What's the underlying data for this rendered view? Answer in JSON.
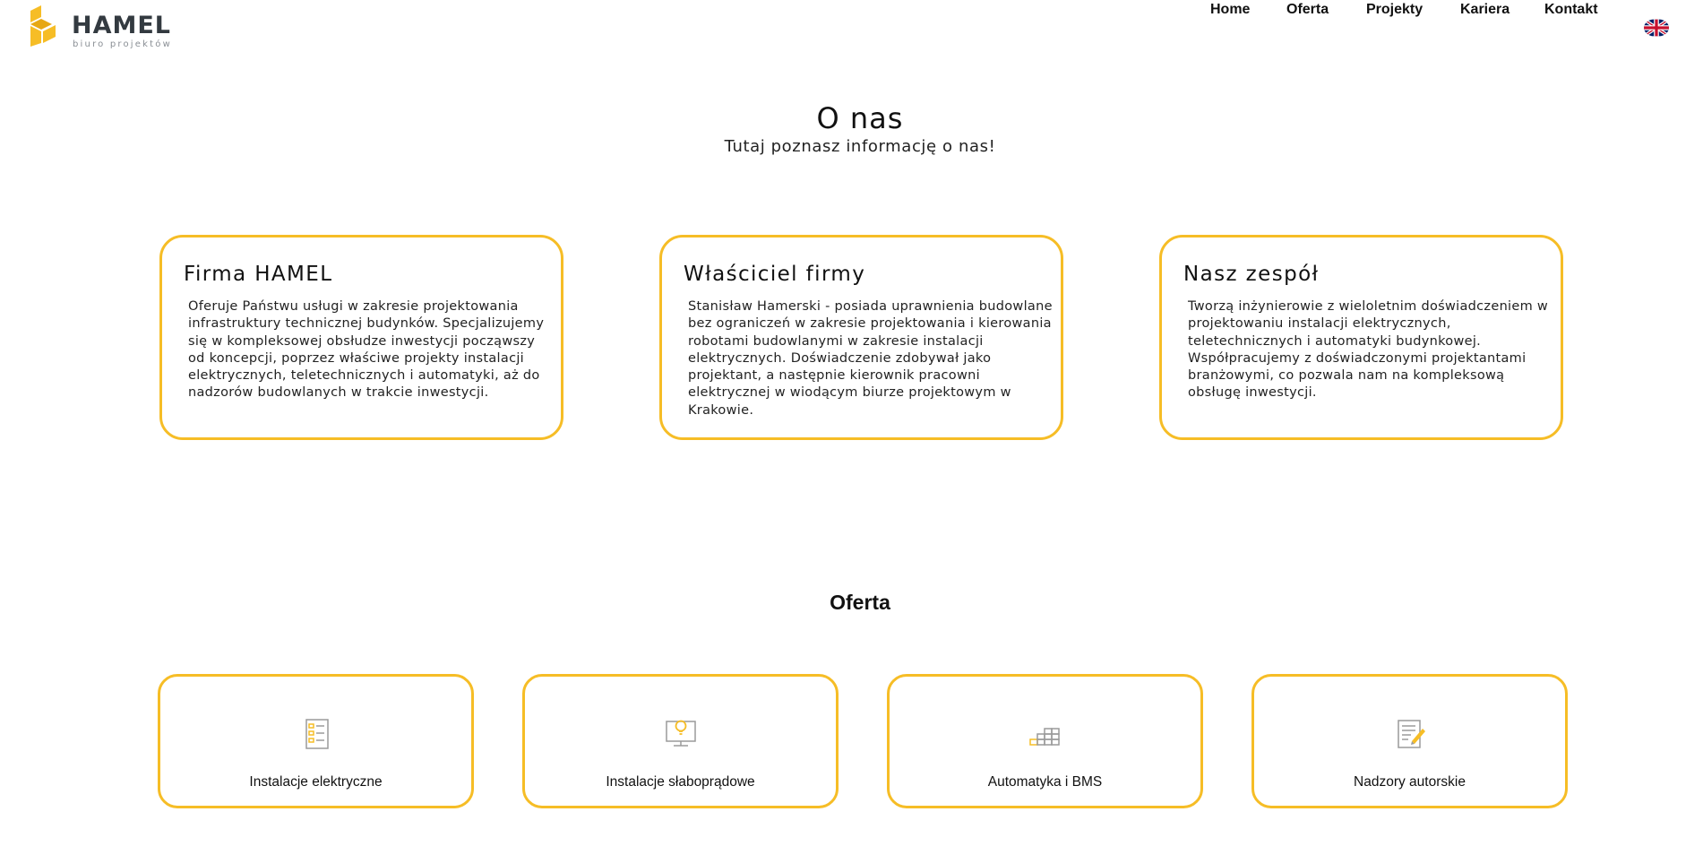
{
  "brand": {
    "name": "HAMEL",
    "tagline": "biuro projektów",
    "accent_color": "#f6bd26"
  },
  "nav": {
    "items": [
      {
        "label": "Home"
      },
      {
        "label": "Oferta"
      },
      {
        "label": "Projekty"
      },
      {
        "label": "Kariera"
      },
      {
        "label": "Kontakt"
      }
    ],
    "language_icon": "uk-flag-icon"
  },
  "about": {
    "title": "O nas",
    "subtitle": "Tutaj poznasz informację o nas!",
    "cards": [
      {
        "title": "Firma HAMEL",
        "text": "Oferuje Państwu usługi w zakresie projektowania infrastruktury technicznej budynków. Specjalizujemy się w kompleksowej obsłudze inwestycji począwszy od koncepcji, poprzez właściwe projekty instalacji elektrycznych, teletechnicznych i automatyki, aż do nadzorów budowlanych w trakcie inwestycji."
      },
      {
        "title": "Właściciel firmy",
        "text": "Stanisław Hamerski - posiada uprawnienia budowlane bez ograniczeń w zakresie projektowania i kierowania robotami budowlanymi w zakresie instalacji elektrycznych. Doświadczenie zdobywał jako projektant, a następnie kierownik pracowni elektrycznej w wiodącym biurze projektowym w Krakowie."
      },
      {
        "title": "Nasz zespół",
        "text": "Tworzą inżynierowie z wieloletnim doświadczeniem w projektowaniu instalacji elektrycznych, teletechnicznych i automatyki budynkowej. Współpracujemy z doświadczonymi projektantami branżowymi, co pozwala nam na kompleksową obsługę inwestycji."
      }
    ]
  },
  "offer": {
    "title": "Oferta",
    "items": [
      {
        "label": "Instalacje elektryczne",
        "icon": "checklist-icon"
      },
      {
        "label": "Instalacje słaboprądowe",
        "icon": "bulb-monitor-icon"
      },
      {
        "label": "Automatyka i BMS",
        "icon": "stairs-blocks-icon"
      },
      {
        "label": "Nadzory autorskie",
        "icon": "document-pen-icon"
      }
    ]
  }
}
